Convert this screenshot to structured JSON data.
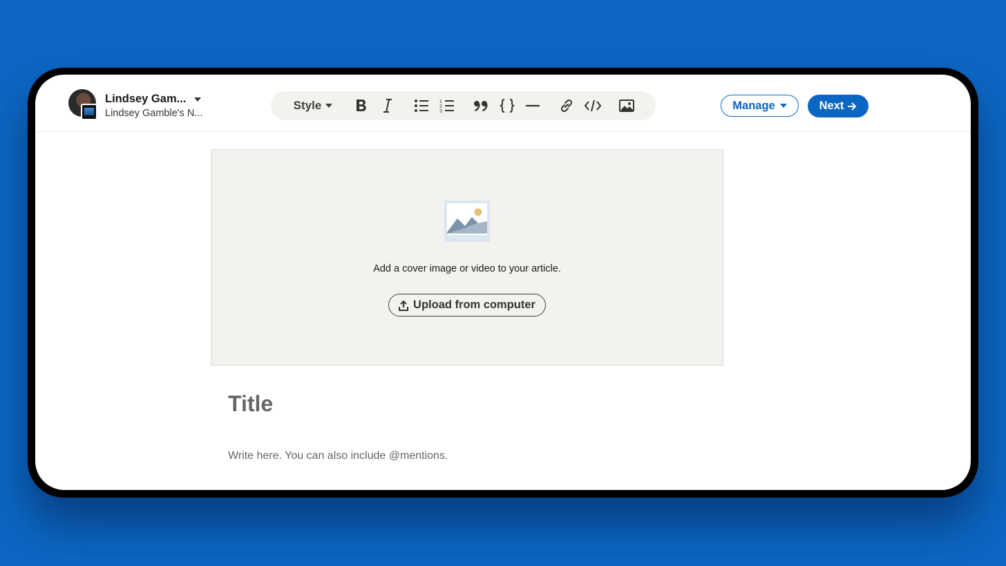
{
  "author": {
    "name": "Lindsey Gam...",
    "newsletter": "Lindsey Gamble's N..."
  },
  "toolbar": {
    "style_label": "Style",
    "icons": [
      "bold-icon",
      "italic-icon",
      "bulleted-list-icon",
      "numbered-list-icon",
      "quote-icon",
      "code-block-icon",
      "divider-icon",
      "link-icon",
      "embed-icon",
      "image-icon"
    ]
  },
  "actions": {
    "manage_label": "Manage",
    "next_label": "Next"
  },
  "cover": {
    "prompt": "Add a cover image or video to your article.",
    "upload_label": "Upload from computer"
  },
  "editor": {
    "title_placeholder": "Title",
    "body_placeholder": "Write here. You can also include @mentions."
  },
  "colors": {
    "brand_blue": "#0a66c2",
    "background_blue": "#0c66c2",
    "cover_bg": "#f3f2ef"
  }
}
